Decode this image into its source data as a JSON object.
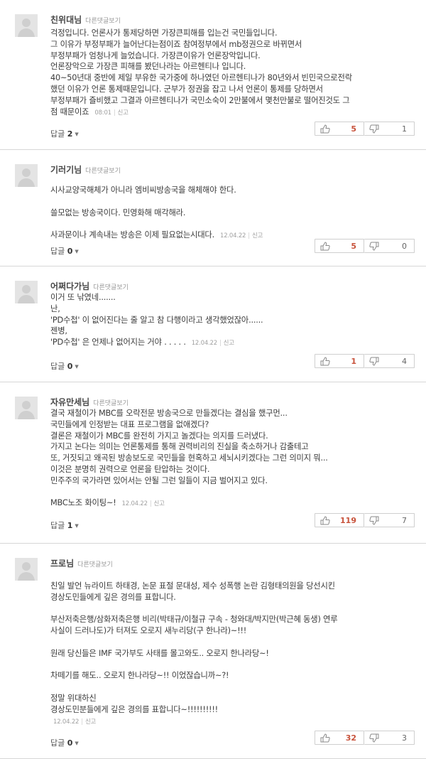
{
  "ui": {
    "other_comments_label": "다른댓글보기",
    "reply_label": "답글",
    "report_label": "신고"
  },
  "comments": [
    {
      "nickname": "친위대님",
      "lines": [
        "걱정입니다. 언론사가 통제당하면 가장큰피해를 입는건 국민들입니다.",
        "그 이유가 부정부패가 늘어난다는점이죠 참여정부에서 mb정권으로 바뀌면서",
        "부정부패가 엄청나게 늘었습니다. 가장큰이유가 언론장악입니다.",
        "언론장악으로 가장큰 피해를 봤던나라는 아르헨티나 입니다.",
        "40~50년대 중반에 제일 부유한 국가중에 하나였던 아르헨티나가 80년와서 빈민국으로전락",
        "했던 이유가 언론 통제때문입니다. 군부가 정권을 잡고 나서 언론이 통제를 당하면서",
        "부정부패가 즐비했고 그결과 아르헨티나가 국민소숙이 2만불에서 몇천만불로 떨어진것도 그",
        "점 때문이죠"
      ],
      "date": "08:01",
      "replies": "2",
      "up": "5",
      "down": "1"
    },
    {
      "nickname": "기러기님",
      "lines": [
        "시사교양국해체가 아니라 엠비씨방송국을 해체해야 한다.",
        "",
        "쓸모없는 방송국이다. 민영화해 매각해라.",
        "",
        "사과문이나 계속내는 방송은 이제 필요없는시대다."
      ],
      "date": "12.04.22",
      "replies": "0",
      "up": "5",
      "down": "0"
    },
    {
      "nickname": "어쩌다가님",
      "lines": [
        "이거 또 낚였네.......",
        "난,",
        "'PD수첩' 이 없어진다는 줄 알고 참 다행이라고 생각했었잖아......",
        "젠병,",
        "'PD수첩' 은 언제나 없어지는 거야 . . . . ."
      ],
      "date": "12.04.22",
      "replies": "0",
      "up": "1",
      "down": "4"
    },
    {
      "nickname": "자유만세님",
      "lines": [
        "결국 재철이가 MBC를 오락전문 방송국으로 만들겠다는 결심을 했구먼...",
        "국민들에게 인정받는 대표 프로그램을 없애겠다?",
        "결론은 재철이가 MBC를 완전히 가지고 놀겠다는 의지를 드러냈다.",
        "가지고 논다는 의미는 언론통제를 통해 권력비리의 진실을 축소하거나 감출테고",
        "또, 거짓되고 왜곡된 방송보도로 국민들을 현혹하고 세뇌시키겠다는 그런 의미지 뭐...",
        "이것은 분명히 권력으로 언론을 탄압하는 것이다.",
        "민주주의 국가라면 있어서는 안될 그런 일들이 지금 벌어지고 있다.",
        "",
        "MBC노조 화이팅~!"
      ],
      "date": "12.04.22",
      "replies": "1",
      "up": "119",
      "down": "7"
    },
    {
      "nickname": "프로님",
      "lines": [
        "친일 발언 뉴라이트 하태경, 논문 표절 문대성, 제수 성폭행 논란 김형태의원을 당선시킨",
        "경상도민들에게 깊은 경의를 표합니다.",
        "",
        "부산저축은행/삼화저축은행 비리(박태규/이철규 구속 - 청와대/박지만(박근혜 동생) 연루",
        "사실이 드러나도)가 터져도 오로지 새누리당(구 한나라)~!!!",
        "",
        "원래 당신들은 IMF 국가부도 사태를 몰고와도.. 오로지 한나라당~!",
        "",
        "차떼기를 해도.. 오로지 한나라당~!! 이었잖습니까~?!",
        "",
        "정말 위대하신",
        "경상도민분들에게 깊은 경의를 표합니다~!!!!!!!!!!"
      ],
      "date": "12.04.22",
      "replies": "0",
      "up": "32",
      "down": "3"
    }
  ]
}
